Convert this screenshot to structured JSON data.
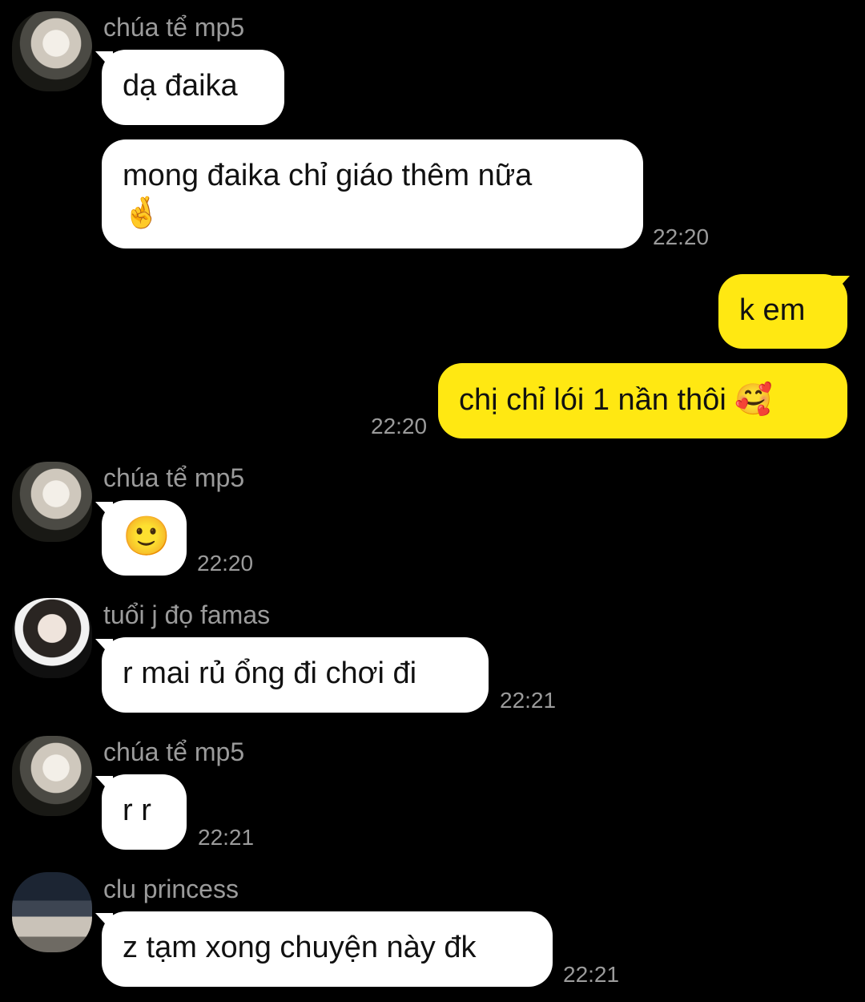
{
  "messages": [
    {
      "sender": "chúa tể mp5",
      "text": "dạ đaika"
    },
    {
      "text": "mong đaika chỉ giáo thêm nữa",
      "emoji": "🤞",
      "time": "22:20"
    },
    {
      "text": "k em"
    },
    {
      "text": "chị chỉ lói 1 nần thôi",
      "emoji": "🥰",
      "time": "22:20"
    },
    {
      "sender": "chúa tể mp5",
      "emoji": "🙂",
      "time": "22:20"
    },
    {
      "sender": "tuổi j đọ famas",
      "text": "r mai rủ ổng đi chơi đi",
      "time": "22:21"
    },
    {
      "sender": "chúa tể mp5",
      "text": "r r",
      "time": "22:21"
    },
    {
      "sender": "clu princess",
      "text": "z tạm xong chuyện này đk",
      "time": "22:21"
    }
  ],
  "colors": {
    "background": "#000000",
    "incoming_bubble": "#ffffff",
    "outgoing_bubble": "#ffe812",
    "meta_text": "#9b9b9b"
  }
}
